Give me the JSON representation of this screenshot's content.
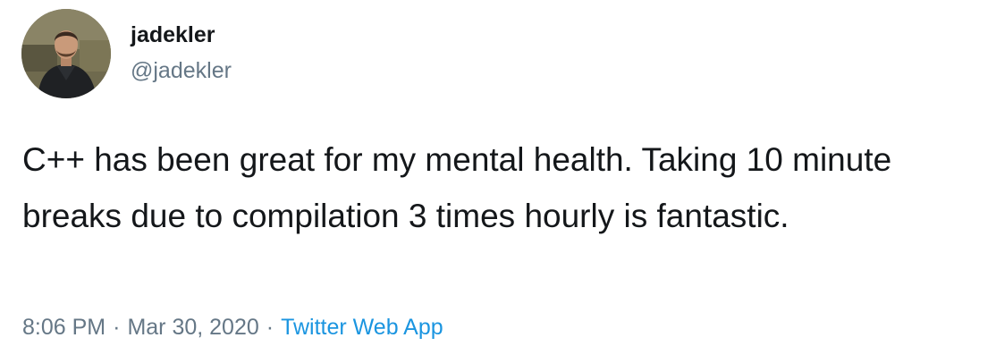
{
  "tweet": {
    "avatar": {
      "icon": "user-photo-avatar",
      "colors": {
        "background": "#6f6a4e",
        "jacket": "#1f2124",
        "skin": "#c99a7a",
        "hair": "#3a2a20"
      }
    },
    "author": {
      "display_name": "jadekler",
      "handle": "@jadekler"
    },
    "text": "C++ has been great for my mental health. Taking 10 minute breaks due to compilation 3 times hourly is fantastic.",
    "meta": {
      "time": "8:06 PM",
      "separator": "·",
      "date": "Mar 30, 2020",
      "source": "Twitter Web App"
    }
  },
  "colors": {
    "text_primary": "#14171a",
    "text_secondary": "#657786",
    "link": "#1b95e0",
    "background": "#ffffff"
  }
}
